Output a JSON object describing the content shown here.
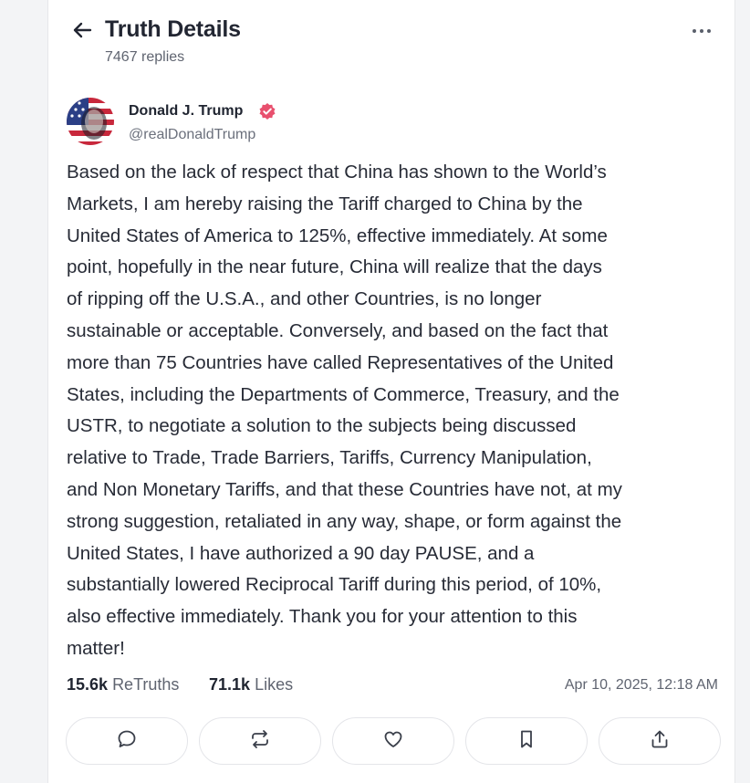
{
  "header": {
    "title": "Truth Details",
    "replies": "7467 replies"
  },
  "post": {
    "author_name": "Donald J. Trump",
    "author_handle": "@realDonaldTrump",
    "text": "Based on the lack of respect that China has shown to the World’s\nMarkets, I am hereby raising the Tariff charged to China by the\nUnited States of America to 125%, effective immediately. At some\npoint, hopefully in the near future, China will realize that the days\nof ripping off the U.S.A., and other Countries, is no longer\nsustainable or acceptable. Conversely, and based on the fact that\nmore than 75 Countries have called Representatives of the United\nStates, including the Departments of Commerce, Treasury, and the\nUSTR, to negotiate a solution to the subjects being discussed\nrelative to Trade, Trade Barriers, Tariffs, Currency Manipulation,\nand Non Monetary Tariffs, and that these Countries have not, at my\nstrong suggestion, retaliated in any way, shape, or form against the\nUnited States, I have authorized a 90 day PAUSE, and a\nsubstantially lowered Reciprocal Tariff during this period, of 10%,\nalso effective immediately. Thank you for your attention to this\nmatter!",
    "retruths_count": "15.6k",
    "retruths_label": "ReTruths",
    "likes_count": "71.1k",
    "likes_label": "Likes",
    "date": "Apr 10, 2025, 12:18 AM"
  },
  "icons": {
    "back": "arrow-left-icon",
    "more": "ellipsis-icon",
    "verified": "verified-badge-icon",
    "actions": [
      "reply-icon",
      "retruth-icon",
      "like-icon",
      "bookmark-icon",
      "share-icon"
    ]
  },
  "colors": {
    "verified": "#e8506e",
    "text": "#272b36",
    "muted": "#5f6470"
  }
}
